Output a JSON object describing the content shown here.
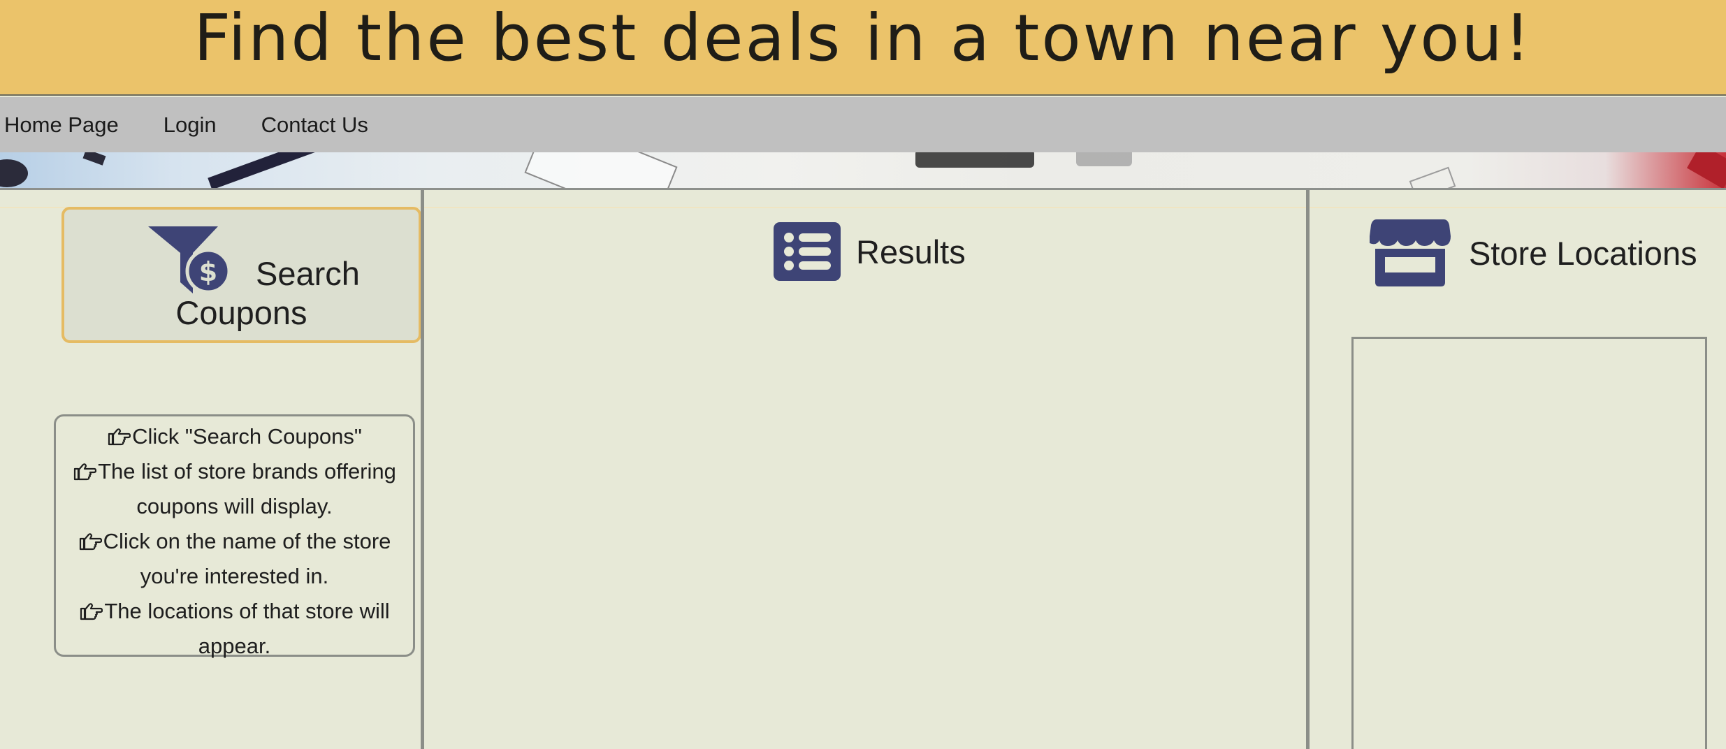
{
  "banner": {
    "title": "Find the best deals in a town near you!"
  },
  "nav": {
    "items": [
      {
        "label": "Home Page"
      },
      {
        "label": "Login"
      },
      {
        "label": "Contact Us"
      }
    ]
  },
  "left": {
    "search_button": {
      "line1": "Search",
      "line2": "Coupons",
      "icon": "coupon-filter-icon"
    },
    "instructions": [
      "Click \"Search Coupons\"",
      "The list of store brands offering",
      "coupons will display.",
      "Click on the name of the store",
      "you're interested in.",
      "The locations of that store will",
      "appear."
    ]
  },
  "middle": {
    "title": "Results",
    "icon": "list-icon"
  },
  "right": {
    "title": "Store Locations",
    "icon": "storefront-icon"
  },
  "colors": {
    "banner": "#ebc36a",
    "nav": "#c0c0c0",
    "background": "#e7e9d7",
    "icon": "#3e4476",
    "accent_border": "#e5bb63"
  }
}
